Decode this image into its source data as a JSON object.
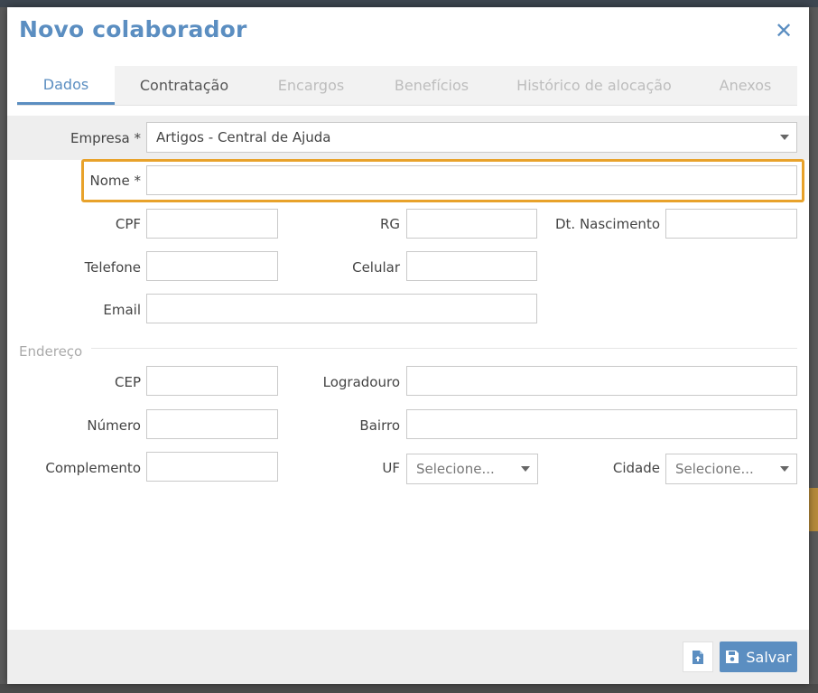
{
  "modal": {
    "title": "Novo colaborador",
    "close_symbol": "✕"
  },
  "tabs": [
    {
      "label": "Dados",
      "state": "active"
    },
    {
      "label": "Contratação",
      "state": "enabled"
    },
    {
      "label": "Encargos",
      "state": "disabled"
    },
    {
      "label": "Benefícios",
      "state": "disabled"
    },
    {
      "label": "Histórico de alocação",
      "state": "disabled"
    },
    {
      "label": "Anexos",
      "state": "disabled"
    }
  ],
  "form": {
    "empresa": {
      "label": "Empresa *",
      "value": "Artigos - Central de Ajuda"
    },
    "nome": {
      "label": "Nome *",
      "value": ""
    },
    "cpf": {
      "label": "CPF",
      "value": ""
    },
    "rg": {
      "label": "RG",
      "value": ""
    },
    "dt_nascimento": {
      "label": "Dt. Nascimento",
      "value": ""
    },
    "telefone": {
      "label": "Telefone",
      "value": ""
    },
    "celular": {
      "label": "Celular",
      "value": ""
    },
    "email": {
      "label": "Email",
      "value": ""
    }
  },
  "endereco": {
    "section_title": "Endereço",
    "cep": {
      "label": "CEP",
      "value": ""
    },
    "logradouro": {
      "label": "Logradouro",
      "value": ""
    },
    "numero": {
      "label": "Número",
      "value": ""
    },
    "bairro": {
      "label": "Bairro",
      "value": ""
    },
    "complemento": {
      "label": "Complemento",
      "value": ""
    },
    "uf": {
      "label": "UF",
      "value": "Selecione..."
    },
    "cidade": {
      "label": "Cidade",
      "value": "Selecione..."
    }
  },
  "footer": {
    "save_label": "Salvar",
    "icons": {
      "attach": "file-upload-icon",
      "save": "floppy-disk-icon"
    }
  },
  "colors": {
    "accent": "#5b8ec1",
    "highlight": "#e8a22b"
  }
}
